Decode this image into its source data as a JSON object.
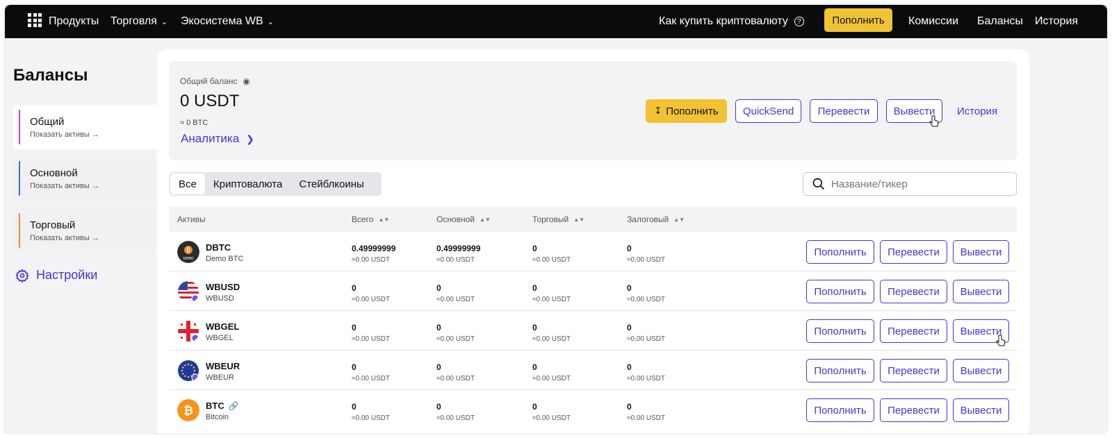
{
  "nav": {
    "products": "Продукты",
    "trading": "Торговля",
    "ecosystem": "Экосистема WB",
    "how_to_buy": "Как купить криптовалюту",
    "deposit": "Пополнить",
    "fees": "Комиссии",
    "balances": "Балансы",
    "history": "История"
  },
  "sidebar": {
    "title": "Балансы",
    "items": [
      {
        "label": "Общий",
        "sub": "Показать активы →",
        "accent": "#d63fb8"
      },
      {
        "label": "Основной",
        "sub": "Показать активы →",
        "accent": "#2f6fe0"
      },
      {
        "label": "Торговый",
        "sub": "Показать активы →",
        "accent": "#f08a24"
      }
    ],
    "settings": "Настройки"
  },
  "balance": {
    "label": "Общий баланс",
    "value": "0 USDT",
    "btc": "≈ 0 BTC",
    "analytics": "Аналитика",
    "buttons": {
      "deposit": "Пополнить",
      "quicksend": "QuickSend",
      "transfer": "Перевести",
      "withdraw": "Вывести",
      "history": "История"
    }
  },
  "tabs": [
    "Все",
    "Криптовалюта",
    "Стейблкоины"
  ],
  "search": {
    "placeholder": "Название/тикер"
  },
  "table": {
    "headers": [
      "Активы",
      "Всего",
      "Основной",
      "Торговый",
      "Залоговый"
    ],
    "row_buttons": {
      "deposit": "Пополнить",
      "transfer": "Перевести",
      "withdraw": "Вывести"
    },
    "rows": [
      {
        "ticker": "DBTC",
        "name": "Demo BTC",
        "total": "0.49999999",
        "total_usdt": "≈0.00 USDT",
        "main": "0.49999999",
        "main_usdt": "≈0.00 USDT",
        "trade": "0",
        "trade_usdt": "≈0.00 USDT",
        "collateral": "0",
        "collateral_usdt": "≈0.00 USDT",
        "icon_text": "DEMO"
      },
      {
        "ticker": "WBUSD",
        "name": "WBUSD",
        "total": "0",
        "total_usdt": "≈0.00 USDT",
        "main": "0",
        "main_usdt": "≈0.00 USDT",
        "trade": "0",
        "trade_usdt": "≈0.00 USDT",
        "collateral": "0",
        "collateral_usdt": "≈0.00 USDT"
      },
      {
        "ticker": "WBGEL",
        "name": "WBGEL",
        "total": "0",
        "total_usdt": "≈0.00 USDT",
        "main": "0",
        "main_usdt": "≈0.00 USDT",
        "trade": "0",
        "trade_usdt": "≈0.00 USDT",
        "collateral": "0",
        "collateral_usdt": "≈0.00 USDT"
      },
      {
        "ticker": "WBEUR",
        "name": "WBEUR",
        "total": "0",
        "total_usdt": "≈0.00 USDT",
        "main": "0",
        "main_usdt": "≈0.00 USDT",
        "trade": "0",
        "trade_usdt": "≈0.00 USDT",
        "collateral": "0",
        "collateral_usdt": "≈0.00 USDT"
      },
      {
        "ticker": "BTC",
        "name": "Bitcoin",
        "total": "0",
        "total_usdt": "≈0.00 USDT",
        "main": "0",
        "main_usdt": "≈0.00 USDT",
        "trade": "0",
        "trade_usdt": "≈0.00 USDT",
        "collateral": "0",
        "collateral_usdt": "≈0.00 USDT"
      }
    ]
  },
  "colors": {
    "accent": "#4b31d6",
    "yellow": "#f1c233",
    "nav_bg": "#0b0b0d"
  },
  "icons": [
    "grid-icon",
    "chevron-down-icon",
    "question-icon",
    "eye-icon",
    "chevron-right-icon",
    "gear-icon",
    "search-icon",
    "sort-icon",
    "link-icon",
    "download-icon",
    "cursor-icon"
  ]
}
